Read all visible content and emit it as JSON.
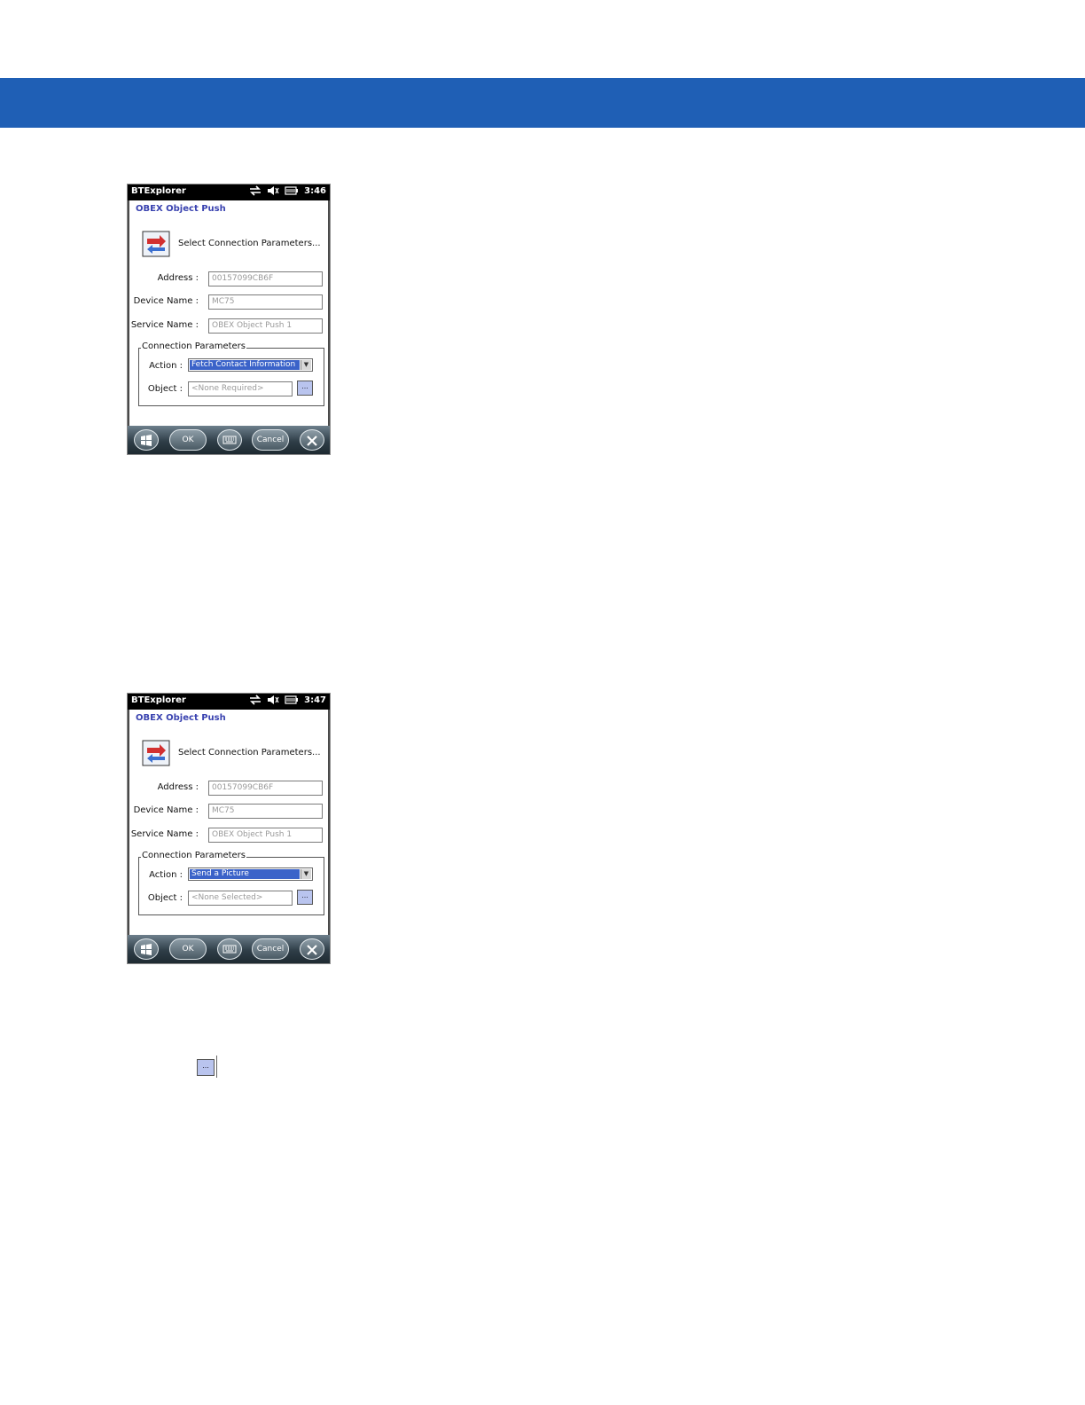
{
  "screens": [
    {
      "app_title": "BTExplorer",
      "clock": "3:46",
      "screen_title": "OBEX Object Push",
      "prompt": "Select Connection Parameters...",
      "address_label": "Address :",
      "address_value": "00157099CB6F",
      "device_name_label": "Device Name :",
      "device_name_value": "MC75",
      "service_name_label": "Service Name :",
      "service_name_value": "OBEX Object Push 1",
      "group_label": "Connection Parameters",
      "action_label": "Action :",
      "action_value": "Fetch Contact Information",
      "object_label": "Object :",
      "object_value": "<None Required>",
      "browse_label": "...",
      "ok_label": "OK",
      "cancel_label": "Cancel"
    },
    {
      "app_title": "BTExplorer",
      "clock": "3:47",
      "screen_title": "OBEX Object Push",
      "prompt": "Select Connection Parameters...",
      "address_label": "Address :",
      "address_value": "00157099CB6F",
      "device_name_label": "Device Name :",
      "device_name_value": "MC75",
      "service_name_label": "Service Name :",
      "service_name_value": "OBEX Object Push 1",
      "group_label": "Connection Parameters",
      "action_label": "Action :",
      "action_value": "Send a Picture",
      "object_label": "Object :",
      "object_value": "<None Selected>",
      "browse_label": "...",
      "ok_label": "OK",
      "cancel_label": "Cancel"
    }
  ],
  "inline_browse_label": "...",
  "colors": {
    "header_band": "#1f5fb5",
    "screen_title": "#3a43b0",
    "selection": "#3b63c9"
  }
}
